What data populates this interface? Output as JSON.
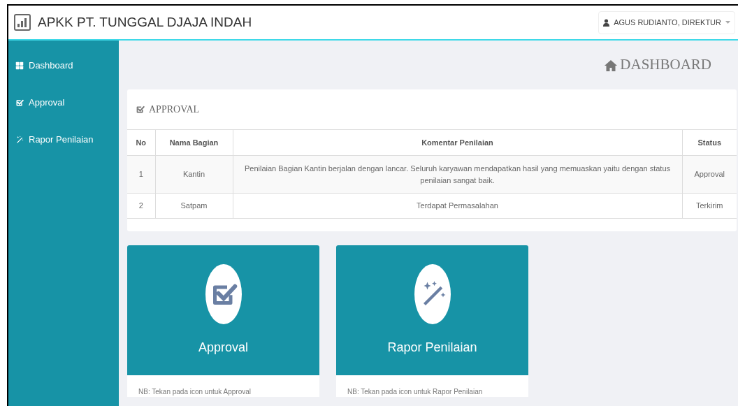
{
  "header": {
    "title": "APKK PT. TUNGGAL DJAJA INDAH",
    "user_menu": "AGUS RUDIANTO, DIREKTUR"
  },
  "sidebar": {
    "items": [
      {
        "label": "Dashboard",
        "kind": "grid"
      },
      {
        "label": "Approval",
        "kind": "check"
      },
      {
        "label": "Rapor Penilaian",
        "kind": "wand"
      }
    ]
  },
  "page_title": "DASHBOARD",
  "approval_panel": {
    "title": "APPROVAL",
    "columns": [
      "No",
      "Nama Bagian",
      "Komentar Penilaian",
      "Status"
    ],
    "rows": [
      [
        "1",
        "Kantin",
        "Penilaian Bagian Kantin berjalan dengan lancar. Seluruh karyawan mendapatkan hasil yang memuaskan yaitu dengan status penilaian sangat baik.",
        "Approval"
      ],
      [
        "2",
        "Satpam",
        "Terdapat Permasalahan",
        "Terkirim"
      ]
    ]
  },
  "cards": [
    {
      "title": "Approval",
      "kind": "check",
      "note": "NB: Tekan pada icon untuk Approval"
    },
    {
      "title": "Rapor Penilaian",
      "kind": "wand",
      "note": "NB: Tekan pada icon untuk Rapor Penilaian"
    }
  ]
}
